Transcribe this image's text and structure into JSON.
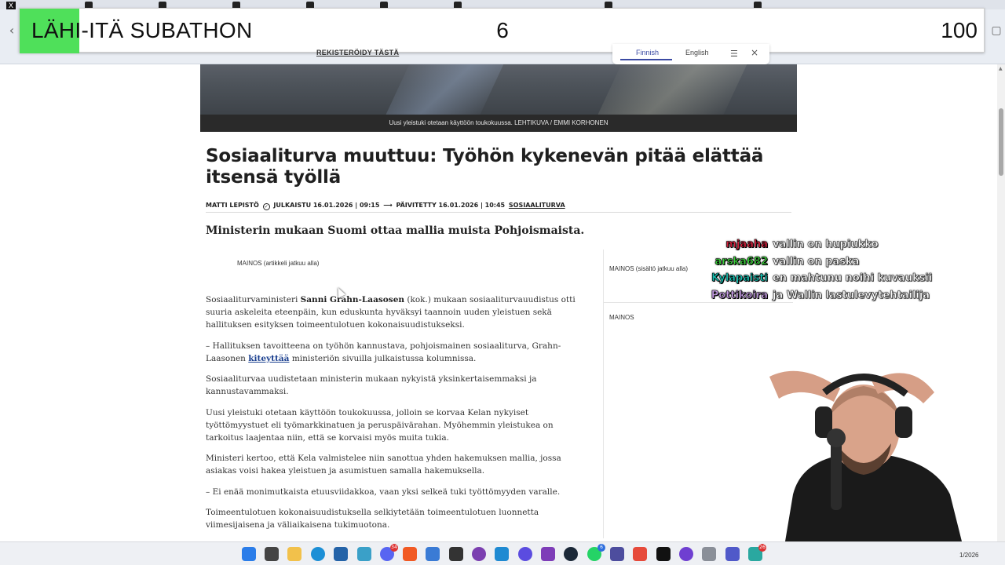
{
  "overlay": {
    "title": "LÄHI-ITÄ SUBATHON",
    "counter_middle": "6",
    "counter_right": "100"
  },
  "site_header": {
    "register_link": "REKISTERÖIDY TÄSTÄ",
    "lang_finnish": "Finnish",
    "lang_english": "English"
  },
  "hero": {
    "caption": "Uusi yleistuki otetaan käyttöön toukokuussa. LEHTIKUVA / EMMI KORHONEN"
  },
  "article": {
    "headline": "Sosiaaliturva muuttuu: Työhön kykenevän pitää elättää itsensä työllä",
    "meta": {
      "author": "MATTI LEPISTÖ",
      "published_label": "JULKAISTU 16.01.2026 | 09:15",
      "arrow": "⟶",
      "updated_label": "PÄIVITETTY 16.01.2026 | 10:45",
      "topic": "SOSIAALITURVA"
    },
    "lede": "Ministerin mukaan Suomi ottaa mallia muista Pohjoismaista.",
    "inline_ad_label": "MAINOS (artikkeli jatkuu alla)",
    "p1_before": "Sosiaaliturvaministeri ",
    "p1_name": "Sanni Grahn-Laasosen",
    "p1_after": " (kok.) mukaan sosiaaliturvauudistus otti suuria askeleita eteenpäin, kun eduskunta hyväksyi taannoin uuden yleistuen sekä hallituksen esityksen toimeentulotuen kokonaisuudistukseksi.",
    "p2_before": "– Hallituksen tavoitteena on työhön kannustava, pohjoismainen sosiaaliturva, Grahn-Laasonen ",
    "p2_link": "kiteyttää",
    "p2_after": " ministeriön sivuilla julkaistussa kolumnissa.",
    "p3": "Sosiaaliturvaa uudistetaan ministerin mukaan nykyistä yksinkertaisemmaksi ja kannustavammaksi.",
    "p4": "Uusi yleistuki otetaan käyttöön toukokuussa, jolloin se korvaa Kelan nykyiset työttömyystuet eli työmarkkinatuen ja peruspäivärahan. Myöhemmin yleistukea on tarkoitus laajentaa niin, että se korvaisi myös muita tukia.",
    "p5": "Ministeri kertoo, että Kela valmistelee niin sanottua yhden hakemuksen mallia, jossa asiakas voisi hakea yleistuen ja asumistuen samalla hakemuksella.",
    "p6": "– Ei enää monimutkaista etuusviidakkoa, vaan yksi selkeä tuki työttömyyden varalle.",
    "p7": "Toimeentulotuen kokonaisuudistuksella selkiytetään toimeentulotuen luonnetta viimesijaisena ja väliaikaisena tukimuotona."
  },
  "sidebar": {
    "ad1_label": "MAINOS (sisältö jatkuu alla)",
    "ad2_label": "MAINOS"
  },
  "chat": {
    "messages": [
      {
        "user": "mjaaha",
        "text": "vallin on hupiukko",
        "color": "#d4213d"
      },
      {
        "user": "arska682",
        "text": "vallin on paska",
        "color": "#3ad13a"
      },
      {
        "user": "Kylapaisti",
        "text": "en mahtunu noihi kuvauksii",
        "color": "#16c2b3"
      },
      {
        "user": "Pottikoira",
        "text": "ja Wallin lastulevytehtailija",
        "color": "#c79ee6"
      }
    ]
  },
  "taskbar": {
    "date": "1/2026",
    "badges": {
      "discord": "34",
      "whatsapp": "6",
      "last": "26"
    }
  },
  "icons": {
    "tab_logo": "x-logo-icon",
    "back": "back-arrow-icon",
    "menu": "menu-icon",
    "close": "close-icon"
  }
}
